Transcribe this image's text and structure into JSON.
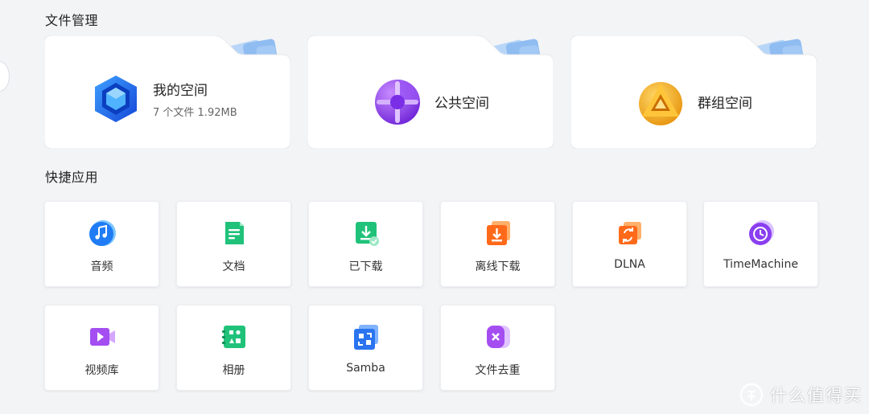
{
  "sections": {
    "file_management": "文件管理",
    "quick_apps": "快捷应用"
  },
  "folders": [
    {
      "id": "my-space",
      "name": "我的空间",
      "subtitle": "7 个文件 1.92MB",
      "icon": "blue-cube-icon",
      "color": "#1e6ff0"
    },
    {
      "id": "public-space",
      "name": "公共空间",
      "icon": "purple-sphere-icon",
      "color": "#8a3ff0"
    },
    {
      "id": "group-space",
      "name": "群组空间",
      "icon": "gold-triangle-icon",
      "color": "#f5a623"
    }
  ],
  "apps": [
    {
      "id": "audio",
      "label": "音频",
      "icon": "music-note-icon",
      "color": "#1f7cf5"
    },
    {
      "id": "docs",
      "label": "文档",
      "icon": "document-icon",
      "color": "#20c27a"
    },
    {
      "id": "downloaded",
      "label": "已下载",
      "icon": "download-done-icon",
      "color": "#20c27a"
    },
    {
      "id": "offline-download",
      "label": "离线下载",
      "icon": "offline-download-icon",
      "color": "#ff6a1a"
    },
    {
      "id": "dlna",
      "label": "DLNA",
      "icon": "dlna-cast-icon",
      "color": "#ff6a1a"
    },
    {
      "id": "timemachine",
      "label": "TimeMachine",
      "icon": "clock-history-icon",
      "color": "#8a3ff0"
    },
    {
      "id": "video-library",
      "label": "视频库",
      "icon": "video-icon",
      "color": "#a44ef2"
    },
    {
      "id": "album",
      "label": "相册",
      "icon": "photo-album-icon",
      "color": "#20c27a"
    },
    {
      "id": "samba",
      "label": "Samba",
      "icon": "samba-share-icon",
      "color": "#2a74f0"
    },
    {
      "id": "dedupe",
      "label": "文件去重",
      "icon": "dedupe-icon",
      "color": "#a44ef2"
    }
  ],
  "watermark": {
    "text": "什么值得买",
    "icon": "smzdm-logo-icon"
  }
}
